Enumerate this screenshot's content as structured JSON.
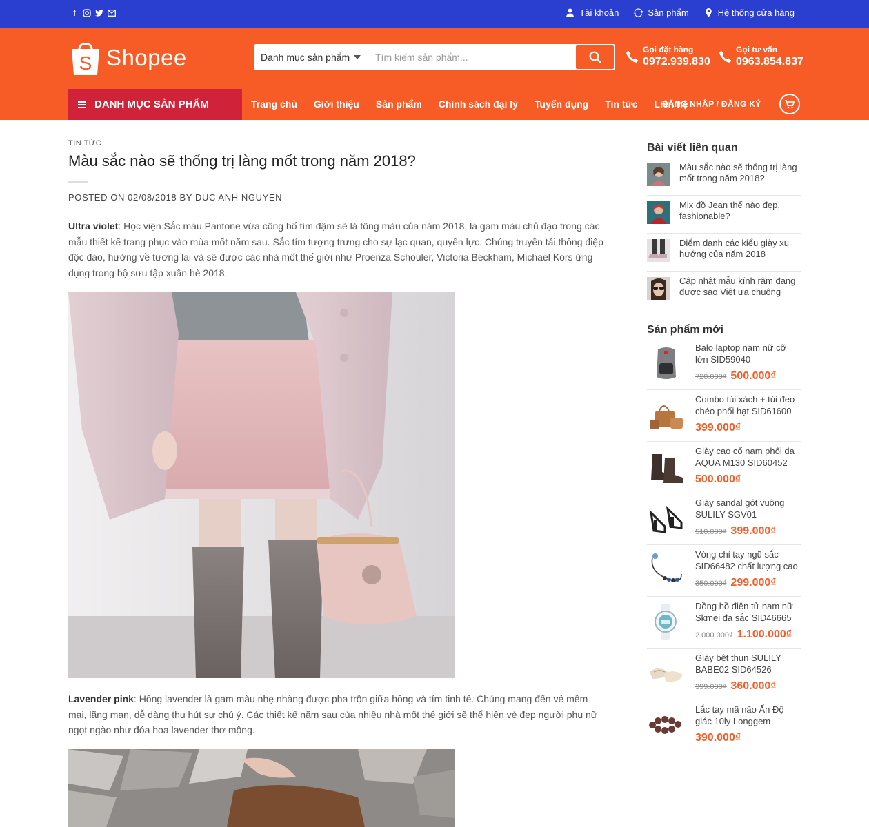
{
  "topbar": {
    "social": [
      "facebook-icon",
      "instagram-icon",
      "twitter-icon",
      "email-icon"
    ],
    "links": [
      {
        "icon": "user-icon",
        "label": "Tài khoản"
      },
      {
        "icon": "refresh-icon",
        "label": "Sản phẩm"
      },
      {
        "icon": "location-icon",
        "label": "Hệ thống cửa hàng"
      }
    ]
  },
  "header": {
    "logo_text": "Shopee",
    "category_select": "Danh mục sản phẩm",
    "search_placeholder": "Tìm kiếm sản phẩm...",
    "hotlines": [
      {
        "label": "Gọi đặt hàng",
        "number": "0972.939.830"
      },
      {
        "label": "Gọi tư vấn",
        "number": "0963.854.837"
      }
    ],
    "category_menu": "DANH MỤC SẢN PHẨM",
    "nav": [
      "Trang chủ",
      "Giới thiệu",
      "Sản phẩm",
      "Chính sách đại lý",
      "Tuyển dụng",
      "Tin tức",
      "Liên hệ"
    ],
    "login": "ĐĂNG NHẬP / ĐĂNG KÝ"
  },
  "article": {
    "category": "TIN TỨC",
    "title": "Màu sắc nào sẽ thống trị làng mốt trong năm 2018?",
    "meta": "POSTED ON 02/08/2018 BY DUC ANH NGUYEN",
    "p1_bold": "Ultra violet",
    "p1_text": ": Học viện Sắc màu Pantone vừa công bố tím đậm sẽ là tông màu của năm 2018, là gam màu chủ đạo trong các mẫu thiết kế trang phục vào mùa mốt năm sau. Sắc tím tượng trưng cho sự lạc quan, quyền lực. Chúng truyền tải thông điệp độc đáo, hướng về tương lai và sẽ được các nhà mốt thế giới như Proenza Schouler, Victoria Beckham, Michael Kors ứng dụng trong bộ sưu tập xuân hè 2018.",
    "p2_bold": "Lavender pink",
    "p2_text": ": Hồng lavender là gam màu nhẹ nhàng được pha trộn giữa hồng và tím tinh tế. Chúng mang đến vẻ mềm mại, lãng mạn, dễ dàng thu hút sự chú ý. Các thiết kế năm sau của nhiều nhà mốt thế giới sẽ thể hiện vẻ đẹp người phụ nữ ngọt ngào như đóa hoa lavender thơ mộng."
  },
  "sidebar": {
    "related_title": "Bài viết liên quan",
    "related": [
      "Màu sắc nào sẽ thống trị làng mốt trong năm 2018?",
      "Mix đồ Jean thế nào đẹp, fashionable?",
      "Điểm danh các kiểu giày xu hướng của năm 2018",
      "Cập nhật mẫu kính râm đang được sao Việt ưa chuộng"
    ],
    "products_title": "Sản phẩm mới",
    "products": [
      {
        "name": "Balo laptop nam nữ cỡ lớn SID59040",
        "old": "720.000₫",
        "price": "500.000₫"
      },
      {
        "name": "Combo túi xách + túi đeo chéo phối hạt SID61600",
        "old": "",
        "price": "399.000₫"
      },
      {
        "name": "Giày cao cổ nam phối da AQUA M130 SID60452",
        "old": "",
        "price": "500.000₫"
      },
      {
        "name": "Giày sandal gót vuông SULILY SGV01",
        "old": "510.000₫",
        "price": "399.000₫"
      },
      {
        "name": "Vòng chỉ tay ngũ sắc SID66482 chất lượng cao",
        "old": "350.000₫",
        "price": "299.000₫"
      },
      {
        "name": "Đồng hồ điện tử nam nữ Skmei đa sắc SID46665",
        "old": "2.000.000₫",
        "price": "1.100.000₫"
      },
      {
        "name": "Giày bệt thun SULILY BABE02 SID64526",
        "old": "399.000₫",
        "price": "360.000₫"
      },
      {
        "name": "Lắc tay mã não Ấn Độ giác 10ly Longgem",
        "old": "",
        "price": "390.000₫"
      }
    ]
  },
  "colors": {
    "topbar": "#2a3fd0",
    "header": "#f85c26",
    "category_menu": "#d0233a",
    "price": "#f85c26"
  }
}
